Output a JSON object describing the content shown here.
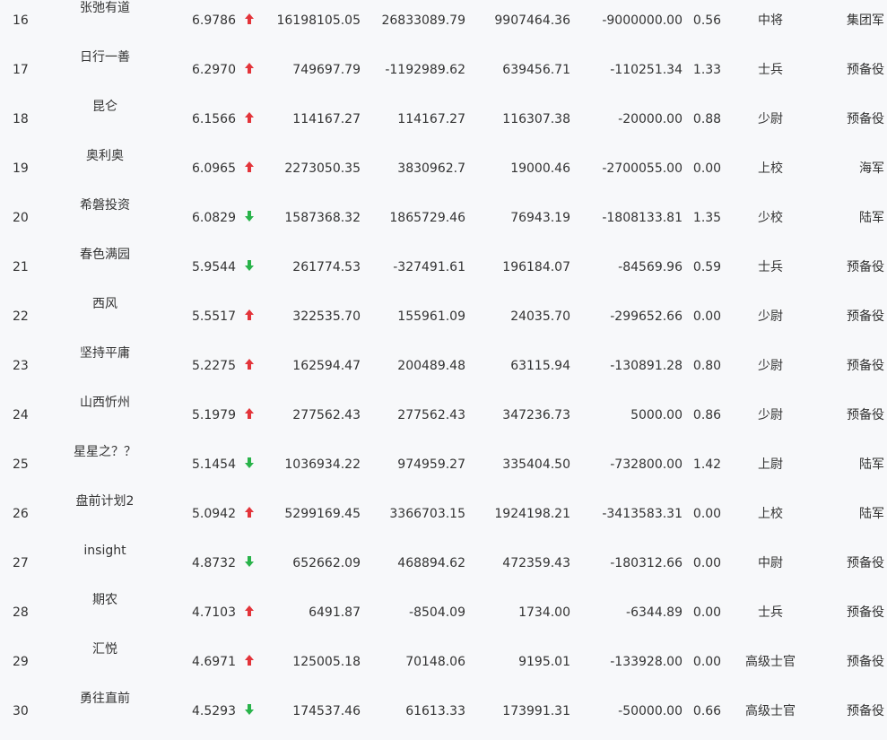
{
  "colors": {
    "up": "#e3343a",
    "down": "#29b34a",
    "text": "#333333",
    "background": "#f7f8fa"
  },
  "rows": [
    {
      "rank": "16",
      "name": "张弛有道",
      "score": "6.9786",
      "trend": "up",
      "v1": "16198105.05",
      "v2": "26833089.79",
      "v3": "9907464.36",
      "v4": "-9000000.00",
      "v5": "0.56",
      "title": "中将",
      "group": "集团军"
    },
    {
      "rank": "17",
      "name": "日行一善",
      "score": "6.2970",
      "trend": "up",
      "v1": "749697.79",
      "v2": "-1192989.62",
      "v3": "639456.71",
      "v4": "-110251.34",
      "v5": "1.33",
      "title": "士兵",
      "group": "预备役"
    },
    {
      "rank": "18",
      "name": "昆仑",
      "score": "6.1566",
      "trend": "up",
      "v1": "114167.27",
      "v2": "114167.27",
      "v3": "116307.38",
      "v4": "-20000.00",
      "v5": "0.88",
      "title": "少尉",
      "group": "预备役"
    },
    {
      "rank": "19",
      "name": "奥利奥",
      "score": "6.0965",
      "trend": "up",
      "v1": "2273050.35",
      "v2": "3830962.7",
      "v3": "19000.46",
      "v4": "-2700055.00",
      "v5": "0.00",
      "title": "上校",
      "group": "海军"
    },
    {
      "rank": "20",
      "name": "希磐投资",
      "score": "6.0829",
      "trend": "down",
      "v1": "1587368.32",
      "v2": "1865729.46",
      "v3": "76943.19",
      "v4": "-1808133.81",
      "v5": "1.35",
      "title": "少校",
      "group": "陆军"
    },
    {
      "rank": "21",
      "name": "春色满园",
      "score": "5.9544",
      "trend": "down",
      "v1": "261774.53",
      "v2": "-327491.61",
      "v3": "196184.07",
      "v4": "-84569.96",
      "v5": "0.59",
      "title": "士兵",
      "group": "预备役"
    },
    {
      "rank": "22",
      "name": "西风",
      "score": "5.5517",
      "trend": "up",
      "v1": "322535.70",
      "v2": "155961.09",
      "v3": "24035.70",
      "v4": "-299652.66",
      "v5": "0.00",
      "title": "少尉",
      "group": "预备役"
    },
    {
      "rank": "23",
      "name": "坚持平庸",
      "score": "5.2275",
      "trend": "up",
      "v1": "162594.47",
      "v2": "200489.48",
      "v3": "63115.94",
      "v4": "-130891.28",
      "v5": "0.80",
      "title": "少尉",
      "group": "预备役"
    },
    {
      "rank": "24",
      "name": "山西忻州",
      "score": "5.1979",
      "trend": "up",
      "v1": "277562.43",
      "v2": "277562.43",
      "v3": "347236.73",
      "v4": "5000.00",
      "v5": "0.86",
      "title": "少尉",
      "group": "预备役"
    },
    {
      "rank": "25",
      "name": "星星之？？",
      "score": "5.1454",
      "trend": "down",
      "v1": "1036934.22",
      "v2": "974959.27",
      "v3": "335404.50",
      "v4": "-732800.00",
      "v5": "1.42",
      "title": "上尉",
      "group": "陆军"
    },
    {
      "rank": "26",
      "name": "盘前计划2",
      "score": "5.0942",
      "trend": "up",
      "v1": "5299169.45",
      "v2": "3366703.15",
      "v3": "1924198.21",
      "v4": "-3413583.31",
      "v5": "0.00",
      "title": "上校",
      "group": "陆军"
    },
    {
      "rank": "27",
      "name": "insight",
      "score": "4.8732",
      "trend": "down",
      "v1": "652662.09",
      "v2": "468894.62",
      "v3": "472359.43",
      "v4": "-180312.66",
      "v5": "0.00",
      "title": "中尉",
      "group": "预备役"
    },
    {
      "rank": "28",
      "name": "期农",
      "score": "4.7103",
      "trend": "up",
      "v1": "6491.87",
      "v2": "-8504.09",
      "v3": "1734.00",
      "v4": "-6344.89",
      "v5": "0.00",
      "title": "士兵",
      "group": "预备役"
    },
    {
      "rank": "29",
      "name": "汇悦",
      "score": "4.6971",
      "trend": "up",
      "v1": "125005.18",
      "v2": "70148.06",
      "v3": "9195.01",
      "v4": "-133928.00",
      "v5": "0.00",
      "title": "高级士官",
      "group": "预备役"
    },
    {
      "rank": "30",
      "name": "勇往直前",
      "score": "4.5293",
      "trend": "down",
      "v1": "174537.46",
      "v2": "61613.33",
      "v3": "173991.31",
      "v4": "-50000.00",
      "v5": "0.66",
      "title": "高级士官",
      "group": "预备役"
    }
  ]
}
